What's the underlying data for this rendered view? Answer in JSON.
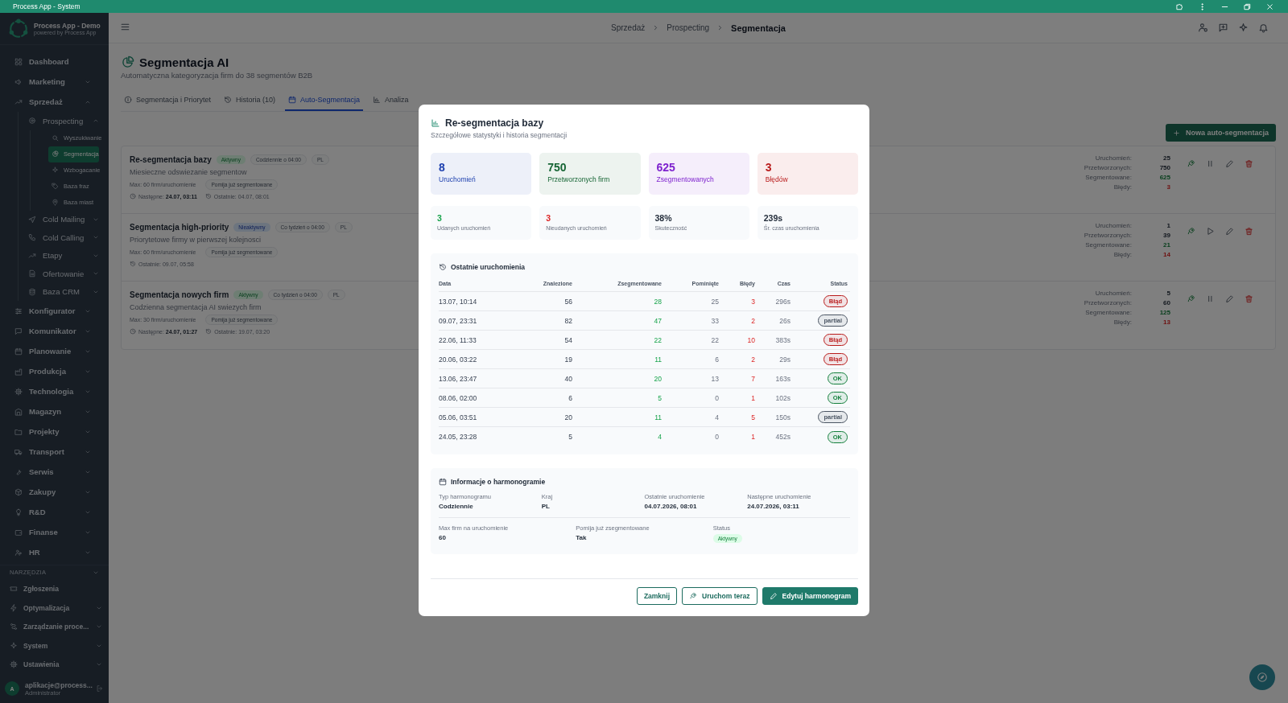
{
  "window": {
    "title": "Process App - System"
  },
  "sidebar": {
    "app_name": "Process App - Demo",
    "app_tagline": "powered by Process App",
    "items": [
      {
        "label": "Dashboard",
        "selected": false
      },
      {
        "label": "Marketing",
        "selected": false,
        "expanded": false
      },
      {
        "label": "Sprzedaż",
        "selected": false,
        "expanded": true,
        "children": [
          {
            "label": "Prospecting",
            "selected": false,
            "expanded": true,
            "children": [
              {
                "label": "Wyszukiwanie",
                "selected": false
              },
              {
                "label": "Segmentacja",
                "selected": true
              },
              {
                "label": "Wzbogacanie",
                "selected": false
              },
              {
                "label": "Baza fraz",
                "selected": false
              },
              {
                "label": "Baza miast",
                "selected": false
              }
            ]
          },
          {
            "label": "Cold Mailing",
            "selected": false,
            "expanded": false
          },
          {
            "label": "Cold Calling",
            "selected": false,
            "expanded": false
          },
          {
            "label": "Etapy",
            "selected": false,
            "expanded": false
          },
          {
            "label": "Ofertowanie",
            "selected": false,
            "expanded": false
          },
          {
            "label": "Baza CRM",
            "selected": false,
            "expanded": false
          }
        ]
      },
      {
        "label": "Konfigurator",
        "selected": false,
        "expanded": false
      },
      {
        "label": "Komunikator",
        "selected": false,
        "expanded": false
      },
      {
        "label": "Planowanie",
        "selected": false,
        "expanded": false
      },
      {
        "label": "Produkcja",
        "selected": false,
        "expanded": false
      },
      {
        "label": "Technologia",
        "selected": false,
        "expanded": false
      },
      {
        "label": "Magazyn",
        "selected": false,
        "expanded": false
      },
      {
        "label": "Projekty",
        "selected": false,
        "expanded": false
      },
      {
        "label": "Transport",
        "selected": false,
        "expanded": false
      },
      {
        "label": "Serwis",
        "selected": false,
        "expanded": false
      },
      {
        "label": "Zakupy",
        "selected": false,
        "expanded": false
      },
      {
        "label": "R&D",
        "selected": false,
        "expanded": false
      },
      {
        "label": "Finanse",
        "selected": false,
        "expanded": false
      },
      {
        "label": "HR",
        "selected": false,
        "expanded": false
      }
    ],
    "tools": {
      "title": "NARZĘDZIA",
      "items": [
        {
          "label": "Zgłoszenia",
          "selected": false
        },
        {
          "label": "Optymalizacja",
          "selected": false,
          "expanded": false
        },
        {
          "label": "Zarządzanie proce...",
          "selected": false,
          "expanded": false
        },
        {
          "label": "System",
          "selected": false,
          "expanded": false
        },
        {
          "label": "Ustawienia",
          "selected": false,
          "expanded": false
        }
      ]
    },
    "user": {
      "initial": "A",
      "email": "aplikacje@process...",
      "role": "Administrator"
    }
  },
  "header": {
    "breadcrumb": [
      "Sprzedaż",
      "Prospecting",
      "Segmentacja"
    ]
  },
  "page": {
    "title": "Segmentacja AI",
    "subtitle": "Automatyczna kategoryzacja firm do 38 segmentów B2B",
    "tabs": [
      {
        "label": "Segmentacja i Priorytet",
        "selected": false
      },
      {
        "label": "Historia (10)",
        "selected": false
      },
      {
        "label": "Auto-Segmentacja",
        "selected": true
      },
      {
        "label": "Analiza",
        "selected": false
      }
    ],
    "new_button": "Nowa auto-segmentacja",
    "schedules": [
      {
        "name": "Re-segmentacja bazy",
        "status": "Aktywny",
        "active": true,
        "frequency": "Codziennie o 04:00",
        "country": "PL",
        "description": "Miesieczne odswiezanie segmentow",
        "max": "Max: 60 firm/uruchomienie",
        "skip_tag": "Pomija już segmentowane",
        "next": "Następne: **24.07, 03:11**",
        "last": "Ostatnie: 04.07, 08:01",
        "running": true,
        "stats": [
          {
            "label": "Uruchomień:",
            "value": "25",
            "kind": "count"
          },
          {
            "label": "Przetworzonych:",
            "value": "750",
            "kind": "count"
          },
          {
            "label": "Segmentowane:",
            "value": "625",
            "kind": "good"
          },
          {
            "label": "Błędy:",
            "value": "3",
            "kind": "bad"
          }
        ]
      },
      {
        "name": "Segmentacja high-priority",
        "status": "Nieaktywny",
        "active": false,
        "frequency": "Co tydzień o 04:00",
        "country": "PL",
        "description": "Priorytetowe firmy w pierwszej kolejnosci",
        "max": "Max: 60 firm/uruchomienie",
        "skip_tag": "Pomija już segmentowane",
        "last": "Ostatnie: 09.07, 05:58",
        "running": false,
        "stats": [
          {
            "label": "Uruchomień:",
            "value": "1",
            "kind": "count"
          },
          {
            "label": "Przetworzonych:",
            "value": "39",
            "kind": "count"
          },
          {
            "label": "Segmentowane:",
            "value": "21",
            "kind": "good"
          },
          {
            "label": "Błędy:",
            "value": "14",
            "kind": "bad"
          }
        ]
      },
      {
        "name": "Segmentacja nowych firm",
        "status": "Aktywny",
        "active": true,
        "frequency": "Co tydzień o 04:00",
        "country": "PL",
        "description": "Codzienna segmentacja AI swiezych firm",
        "max": "Max: 30 firm/uruchomienie",
        "skip_tag": "Pomija już segmentowane",
        "next": "Następne: **24.07, 01:27**",
        "last": "Ostatnie: 19.07, 03:20",
        "running": true,
        "stats": [
          {
            "label": "Uruchomień:",
            "value": "5",
            "kind": "count"
          },
          {
            "label": "Przetworzonych:",
            "value": "60",
            "kind": "count"
          },
          {
            "label": "Segmentowane:",
            "value": "125",
            "kind": "good"
          },
          {
            "label": "Błędy:",
            "value": "13",
            "kind": "bad"
          }
        ]
      }
    ]
  },
  "modal": {
    "title": "Re-segmentacja bazy",
    "subtitle": "Szczegółowe statystyki i historia segmentacji",
    "summary": [
      {
        "value": "8",
        "label": "Uruchomień",
        "color": "#1e40af"
      },
      {
        "value": "750",
        "label": "Przetworzonych firm",
        "color": "#166534"
      },
      {
        "value": "625",
        "label": "Zsegmentowanych",
        "color": "#7e22ce"
      },
      {
        "value": "3",
        "label": "Błędów",
        "color": "#b91c1c"
      }
    ],
    "metrics": [
      {
        "value": "3",
        "label": "Udanych uruchomień",
        "color": "#16a34a"
      },
      {
        "value": "3",
        "label": "Nieudanych uruchomień",
        "color": "#dc2626"
      },
      {
        "value": "38%",
        "label": "Skuteczność",
        "color": "#1f2937"
      },
      {
        "value": "239s",
        "label": "Śr. czas uruchomienia",
        "color": "#1f2937"
      }
    ],
    "runs": {
      "title": "Ostatnie uruchomienia",
      "columns": [
        "Data",
        "Znalezione",
        "Zsegmentowane",
        "Pominięte",
        "Błędy",
        "Czas",
        "Status"
      ],
      "rows": [
        {
          "date": "13.07, 10:14",
          "found": "56",
          "segmented": "28",
          "skipped": "25",
          "errors": "3",
          "time": "296s",
          "status": {
            "label": "Błąd",
            "color": "#b91c1c"
          }
        },
        {
          "date": "09.07, 23:31",
          "found": "82",
          "segmented": "47",
          "skipped": "33",
          "errors": "2",
          "time": "26s",
          "status": {
            "label": "partial",
            "color": "#4b5563"
          }
        },
        {
          "date": "22.06, 11:33",
          "found": "54",
          "segmented": "22",
          "skipped": "22",
          "errors": "10",
          "time": "383s",
          "status": {
            "label": "Błąd",
            "color": "#b91c1c"
          }
        },
        {
          "date": "20.06, 03:22",
          "found": "19",
          "segmented": "11",
          "skipped": "6",
          "errors": "2",
          "time": "29s",
          "status": {
            "label": "Błąd",
            "color": "#b91c1c"
          }
        },
        {
          "date": "13.06, 23:47",
          "found": "40",
          "segmented": "20",
          "skipped": "13",
          "errors": "7",
          "time": "163s",
          "status": {
            "label": "OK",
            "color": "#15803d"
          }
        },
        {
          "date": "08.06, 02:00",
          "found": "6",
          "segmented": "5",
          "skipped": "0",
          "errors": "1",
          "time": "102s",
          "status": {
            "label": "OK",
            "color": "#15803d"
          }
        },
        {
          "date": "05.06, 03:51",
          "found": "20",
          "segmented": "11",
          "skipped": "4",
          "errors": "5",
          "time": "150s",
          "status": {
            "label": "partial",
            "color": "#4b5563"
          }
        },
        {
          "date": "24.05, 23:28",
          "found": "5",
          "segmented": "4",
          "skipped": "0",
          "errors": "1",
          "time": "452s",
          "status": {
            "label": "OK",
            "color": "#15803d"
          }
        }
      ]
    },
    "schedule": {
      "title": "Informacje o harmonogramie",
      "fields": [
        {
          "label": "Typ harmonogramu",
          "value": "Codziennie"
        },
        {
          "label": "Kraj",
          "value": "PL"
        },
        {
          "label": "Ostatnie uruchomienie",
          "value": "04.07.2026, 08:01"
        },
        {
          "label": "Następne uruchomienie",
          "value": "24.07.2026, 03:11"
        }
      ],
      "fields_2": [
        {
          "label": "Max firm na uruchomienie",
          "value": "60",
          "kind": "text"
        },
        {
          "label": "Pomija już zsegmentowane",
          "value": "Tak",
          "kind": "text"
        },
        {
          "label": "Status",
          "value": "Aktywny",
          "kind": "badge"
        }
      ]
    },
    "buttons": [
      {
        "label": "Zamknij",
        "kind": "secondary"
      },
      {
        "label": "Uruchom teraz",
        "kind": "secondary"
      },
      {
        "label": "Edytuj harmonogram",
        "kind": "primary"
      }
    ]
  }
}
